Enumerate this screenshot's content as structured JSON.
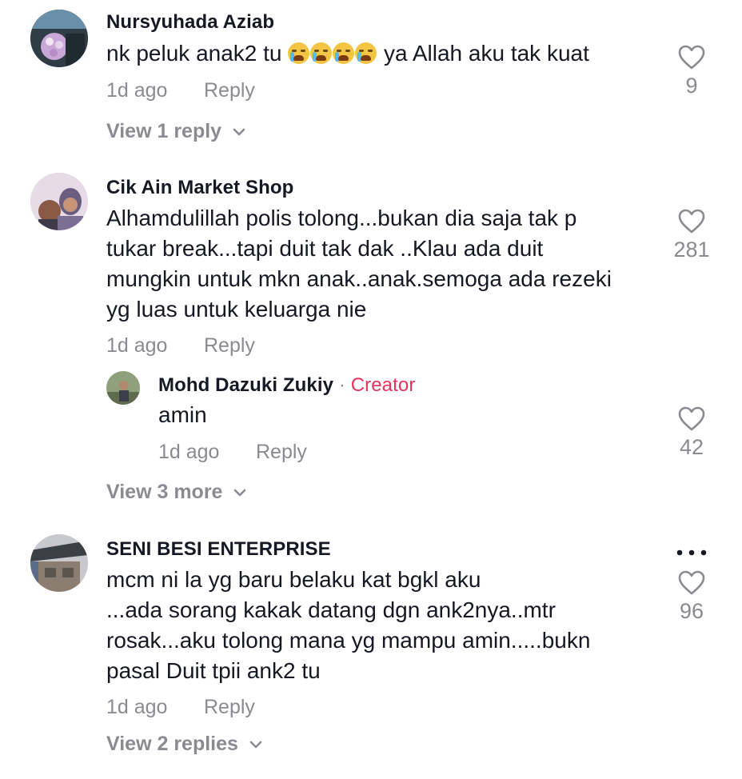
{
  "comments": [
    {
      "author": "Nursyuhada Aziab",
      "text_before_emoji": "nk peluk anak2 tu ",
      "emoji": [
        "loudly-crying-face",
        "loudly-crying-face",
        "loudly-crying-face",
        "loudly-crying-face"
      ],
      "text_after_emoji": " ya Allah aku tak kuat",
      "time": "1d ago",
      "reply_label": "Reply",
      "likes": "9",
      "view_label": "View 1 reply"
    },
    {
      "author": "Cik Ain Market Shop",
      "lines": [
        "Alhamdulillah polis tolong...bukan dia saja tak p",
        "tukar break...tapi duit tak dak ..Klau ada duit",
        "mungkin untuk mkn anak..anak.semoga ada rezeki",
        "yg luas untuk keluarga nie"
      ],
      "time": "1d ago",
      "reply_label": "Reply",
      "likes": "281",
      "reply": {
        "author": "Mohd Dazuki Zukiy",
        "separator": " · ",
        "badge": "Creator",
        "text": "amin",
        "time": "1d ago",
        "reply_label": "Reply",
        "likes": "42"
      },
      "view_label": "View 3 more"
    },
    {
      "author": "SENI BESI ENTERPRISE",
      "lines": [
        "mcm ni la yg baru belaku kat bgkl aku",
        "...ada sorang kakak datang dgn ank2nya..mtr",
        "rosak...aku tolong mana yg mampu amin.....bukn",
        "pasal Duit tpii ank2 tu"
      ],
      "time": "1d ago",
      "reply_label": "Reply",
      "likes": "96",
      "view_label": "View 2 replies"
    }
  ],
  "colors": {
    "meta": "#8a8b91",
    "creator": "#e3355c",
    "text": "#161823"
  },
  "icons": {
    "like": "heart-outline-icon",
    "chevron": "chevron-down-icon",
    "more": "more-horizontal-icon"
  }
}
